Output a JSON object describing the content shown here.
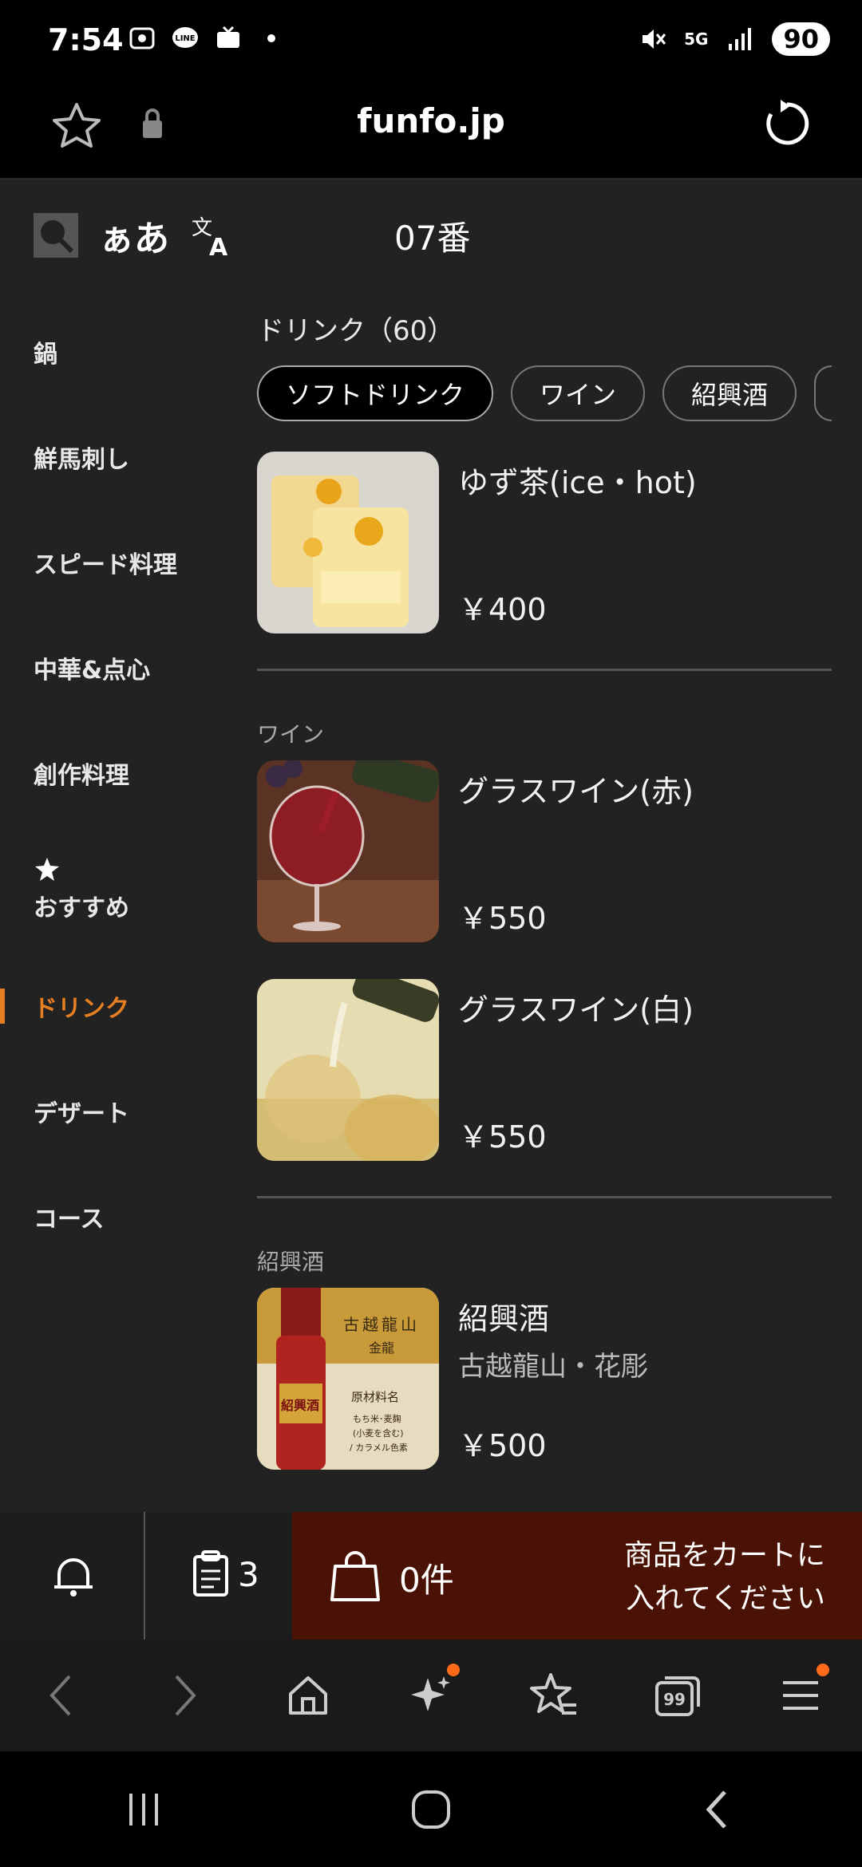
{
  "status": {
    "time": "7:54",
    "battery": "90",
    "network": "5G"
  },
  "browser": {
    "url": "funfo.jp"
  },
  "app": {
    "tools": {
      "font_size_label": "ぁあ"
    },
    "table_number": "07番",
    "sidebar": [
      {
        "label": "鍋"
      },
      {
        "label": "鮮馬刺し"
      },
      {
        "label": "スピード料理"
      },
      {
        "label": "中華&点心"
      },
      {
        "label": "創作料理"
      },
      {
        "label": "おすすめ"
      },
      {
        "label": "ドリンク"
      },
      {
        "label": "デザート"
      },
      {
        "label": "コース"
      }
    ],
    "category_title": "ドリンク（60）",
    "chips": [
      {
        "label": "ソフトドリンク"
      },
      {
        "label": "ワイン"
      },
      {
        "label": "紹興酒"
      }
    ],
    "items": [
      {
        "name": "ゆず茶(ice・hot)",
        "price": "￥400"
      },
      {
        "name": "グラスワイン(赤)",
        "price": "￥550"
      },
      {
        "name": "グラスワイン(白)",
        "price": "￥550"
      },
      {
        "name": "紹興酒",
        "sub": "古越龍山・花彫",
        "price": "￥500"
      }
    ],
    "sections": {
      "wine": "ワイン",
      "shaoxing": "紹興酒"
    },
    "label_text": {
      "line1": "古越龍山",
      "line2": "金龍",
      "line3": "原材料名",
      "line4": "もち米･麦麹",
      "line5": "(小麦を含む)",
      "line6": "/ カラメル色素",
      "bottle": "紹興酒"
    }
  },
  "cartbar": {
    "orders_count": "3",
    "cart_count": "0件",
    "message_line1": "商品をカートに",
    "message_line2": "入れてください"
  },
  "colors": {
    "accent": "#e67e22",
    "cart_bg": "#4a1204",
    "app_bg": "#222222"
  }
}
